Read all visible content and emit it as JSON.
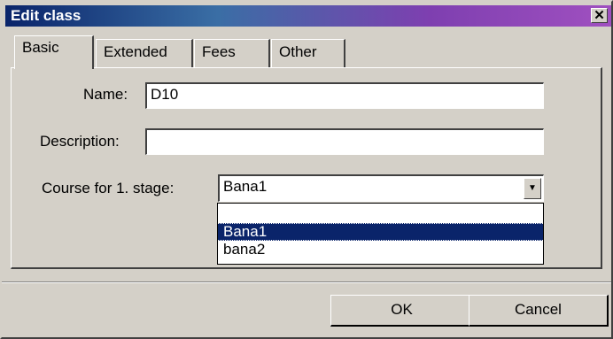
{
  "window": {
    "title": "Edit class",
    "close_symbol": "✕"
  },
  "tabs": [
    {
      "label": "Basic",
      "active": true
    },
    {
      "label": "Extended",
      "active": false
    },
    {
      "label": "Fees",
      "active": false
    },
    {
      "label": "Other",
      "active": false
    }
  ],
  "form": {
    "name_label": "Name:",
    "name_value": "D10",
    "description_label": "Description:",
    "description_value": "",
    "course_label": "Course for 1. stage:",
    "course_value": "Bana1",
    "course_options": [
      "",
      "Bana1",
      "bana2"
    ],
    "course_selected": "Bana1"
  },
  "buttons": {
    "ok": "OK",
    "cancel": "Cancel"
  },
  "colors": {
    "titlebar_start": "#0a246a",
    "titlebar_end": "#a050c0",
    "selection": "#0a246a",
    "face": "#d4d0c8"
  }
}
